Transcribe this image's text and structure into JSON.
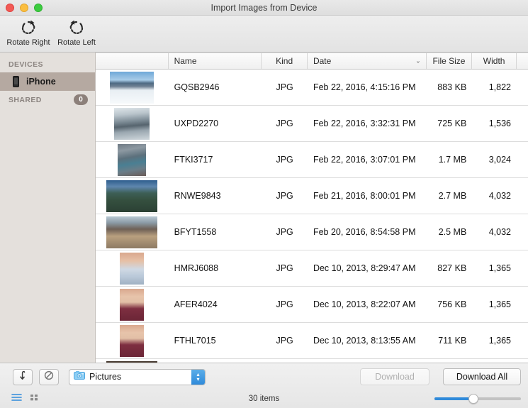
{
  "window": {
    "title": "Import Images from Device",
    "traffic_lights": [
      "close-button",
      "minimize-button",
      "maximize-button"
    ]
  },
  "toolbar": {
    "buttons": [
      {
        "id": "rotate-right",
        "label": "Rotate Right",
        "icon": "rotate-right-icon"
      },
      {
        "id": "rotate-left",
        "label": "Rotate Left",
        "icon": "rotate-left-icon"
      }
    ]
  },
  "sidebar": {
    "sections": [
      {
        "header": "DEVICES",
        "badge": null,
        "items": [
          {
            "label": "iPhone",
            "icon": "iphone-icon",
            "selected": true
          }
        ]
      },
      {
        "header": "SHARED",
        "badge": "0",
        "items": []
      }
    ]
  },
  "file_list": {
    "columns": [
      {
        "key": "thumb",
        "label": ""
      },
      {
        "key": "name",
        "label": "Name"
      },
      {
        "key": "kind",
        "label": "Kind"
      },
      {
        "key": "date",
        "label": "Date",
        "sorted": true,
        "sort_caret": "⌄"
      },
      {
        "key": "size",
        "label": "File Size"
      },
      {
        "key": "width",
        "label": "Width"
      }
    ],
    "rows": [
      {
        "name": "GQSB2946",
        "kind": "JPG",
        "date": "Feb 22, 2016, 4:15:16 PM",
        "size": "883 KB",
        "width": "1,822",
        "thumb": "snowy-mountain-hiker"
      },
      {
        "name": "UXPD2270",
        "kind": "JPG",
        "date": "Feb 22, 2016, 3:32:31 PM",
        "size": "725 KB",
        "width": "1,536",
        "thumb": "glacier-climber"
      },
      {
        "name": "FTKI3717",
        "kind": "JPG",
        "date": "Feb 22, 2016, 3:07:01 PM",
        "size": "1.7 MB",
        "width": "3,024",
        "thumb": "ice-crevasse"
      },
      {
        "name": "RNWE9843",
        "kind": "JPG",
        "date": "Feb 21, 2016, 8:00:01 PM",
        "size": "2.7 MB",
        "width": "4,032",
        "thumb": "mountain-road"
      },
      {
        "name": "BFYT1558",
        "kind": "JPG",
        "date": "Feb 20, 2016, 8:54:58 PM",
        "size": "2.5 MB",
        "width": "4,032",
        "thumb": "red-car-lake"
      },
      {
        "name": "HMRJ6088",
        "kind": "JPG",
        "date": "Dec 10, 2013, 8:29:47 AM",
        "size": "827 KB",
        "width": "1,365",
        "thumb": "portrait-blue-shirt"
      },
      {
        "name": "AFER4024",
        "kind": "JPG",
        "date": "Dec 10, 2013, 8:22:07 AM",
        "size": "756 KB",
        "width": "1,365",
        "thumb": "portrait-maroon-a"
      },
      {
        "name": "FTHL7015",
        "kind": "JPG",
        "date": "Dec 10, 2013, 8:13:55 AM",
        "size": "711 KB",
        "width": "1,365",
        "thumb": "portrait-maroon-b"
      },
      {
        "name": "",
        "kind": "",
        "date": "",
        "size": "",
        "width": "",
        "thumb": "interior-room"
      }
    ]
  },
  "bottom_bar": {
    "rotate_back_icon": "rotate-back-icon",
    "delete_icon": "no-entry-icon",
    "destination": {
      "label": "Pictures",
      "icon": "pictures-folder-icon",
      "stepper_up": "▴",
      "stepper_down": "▾"
    },
    "download_label": "Download",
    "download_enabled": false,
    "download_all_label": "Download All",
    "list_view_icon": "list-view-icon",
    "grid_view_icon": "grid-view-icon",
    "active_view": "list",
    "item_count": "30 items",
    "zoom_slider_percent": 45
  },
  "colors": {
    "accent_blue": "#2f8ada",
    "sidebar_bg": "#e4e0dc",
    "sidebar_selected": "#b5a9a1",
    "badge_bg": "#8c807a",
    "toolbar_bg": "#e9e9e9"
  }
}
